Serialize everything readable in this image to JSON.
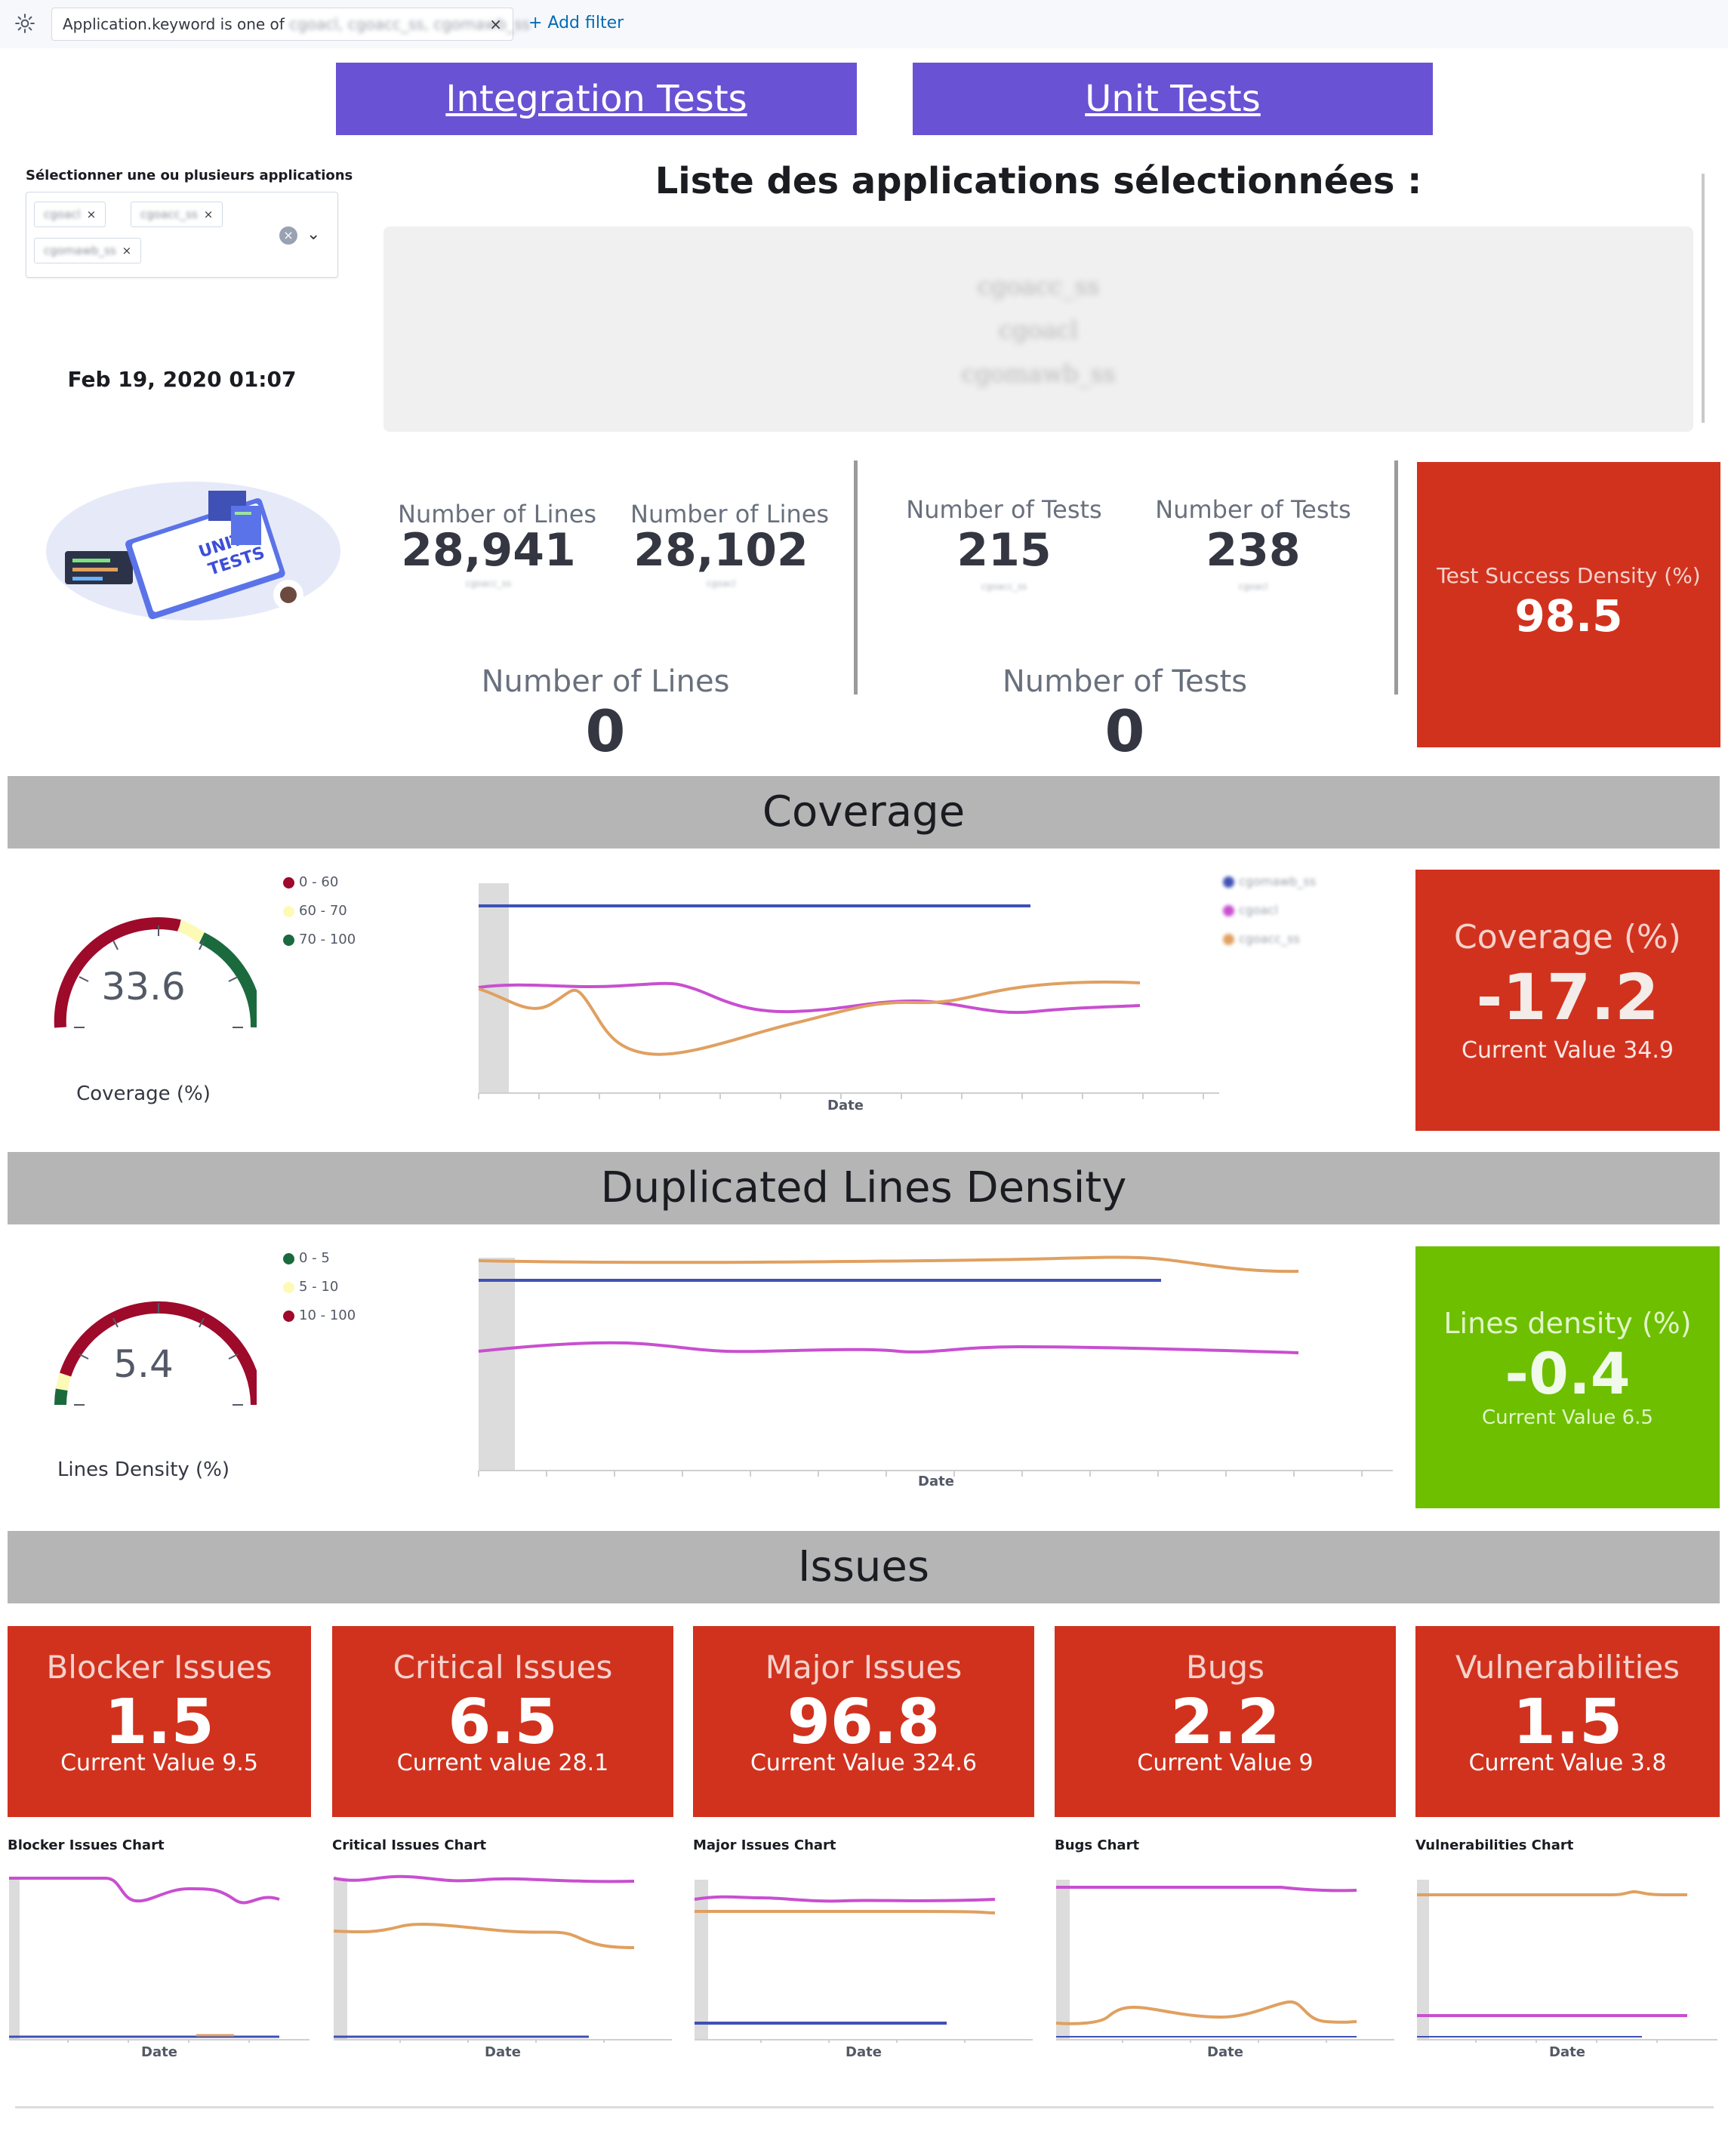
{
  "filter_bar": {
    "filter_prefix": "Application.keyword is one of",
    "filter_values": "cgoacl, cgoacc_ss, cgomawb_ss",
    "filter_close": "×",
    "add_filter": "+ Add filter"
  },
  "nav_buttons": {
    "integration": "Integration Tests",
    "unit": "Unit Tests"
  },
  "selector": {
    "label": "Sélectionner une ou plusieurs applications",
    "chips": [
      "cgoacl",
      "cgoacc_ss",
      "cgomawb_ss"
    ],
    "chip_close": "×",
    "clear": "×",
    "chevron": "⌄"
  },
  "date": "Feb 19, 2020 01:07",
  "applications": {
    "title": "Liste des applications sélectionnées :",
    "items": [
      "cgoacc_ss",
      "cgoacl",
      "cgomawb_ss"
    ]
  },
  "illustration": {
    "line1": "UNIT",
    "line2": "TESTS"
  },
  "metrics": {
    "lines": [
      {
        "label": "Number of Lines",
        "value": "28,941",
        "sub": "cgoacc_ss"
      },
      {
        "label": "Number of Lines",
        "value": "28,102",
        "sub": "cgoacl"
      }
    ],
    "tests": [
      {
        "label": "Number of Tests",
        "value": "215",
        "sub": "cgoacc_ss"
      },
      {
        "label": "Number of Tests",
        "value": "238",
        "sub": "cgoacl"
      }
    ],
    "lines_total": {
      "label": "Number of Lines",
      "value": "0"
    },
    "tests_total": {
      "label": "Number of Tests",
      "value": "0"
    }
  },
  "test_success": {
    "label": "Test Success Density (%)",
    "value": "98.5",
    "color": "#d1321e"
  },
  "sections": {
    "coverage": "Coverage",
    "duplicated": "Duplicated Lines Density",
    "issues": "Issues"
  },
  "coverage": {
    "gauge": {
      "value": 33.6,
      "display": "33.6",
      "label": "Coverage (%)",
      "min": 0,
      "max": 100
    },
    "gauge_legend": [
      {
        "label": "0 - 60",
        "color": "#9e0a2a"
      },
      {
        "label": "60 - 70",
        "color": "#fdfab8"
      },
      {
        "label": "70 - 100",
        "color": "#1b6a3d"
      }
    ],
    "series_legend": [
      {
        "label": "cgomawb_ss",
        "color": "#3f51b5"
      },
      {
        "label": "cgoacl",
        "color": "#c84fd0"
      },
      {
        "label": "cgoacc_ss",
        "color": "#e0a060"
      }
    ],
    "xlabel": "Date",
    "tile": {
      "label": "Coverage (%)",
      "value": "-17.2",
      "current": "Current Value 34.9",
      "color": "#d1321e"
    }
  },
  "duplicated": {
    "gauge": {
      "value": 5.4,
      "display": "5.4",
      "label": "Lines Density (%)",
      "min": 0,
      "max": 100
    },
    "gauge_legend": [
      {
        "label": "0 - 5",
        "color": "#1b6a3d"
      },
      {
        "label": "5 - 10",
        "color": "#fdfab8"
      },
      {
        "label": "10 - 100",
        "color": "#9e0a2a"
      }
    ],
    "xlabel": "Date",
    "tile": {
      "label": "Lines density (%)",
      "value": "-0.4",
      "current": "Current Value 6.5",
      "color": "#6dbf00"
    }
  },
  "issues": [
    {
      "label": "Blocker Issues",
      "value": "1.5",
      "current": "Current Value 9.5",
      "chart_title": "Blocker Issues Chart",
      "xlabel": "Date"
    },
    {
      "label": "Critical Issues",
      "value": "6.5",
      "current": "Current value 28.1",
      "chart_title": "Critical Issues Chart",
      "xlabel": "Date"
    },
    {
      "label": "Major Issues",
      "value": "96.8",
      "current": "Current Value 324.6",
      "chart_title": "Major Issues Chart",
      "xlabel": "Date"
    },
    {
      "label": "Bugs",
      "value": "2.2",
      "current": "Current Value 9",
      "chart_title": "Bugs Chart",
      "xlabel": "Date"
    },
    {
      "label": "Vulnerabilities",
      "value": "1.5",
      "current": "Current Value 3.8",
      "chart_title": "Vulnerabilities Chart",
      "xlabel": "Date"
    }
  ],
  "colors": {
    "accent_purple": "#6a52d4",
    "alert_red": "#d1321e",
    "ok_green": "#6dbf00",
    "section_gray": "#b5b5b5"
  },
  "icons": {
    "settings": "gear-icon",
    "clear": "clear-icon",
    "chevron": "chevron-down-icon"
  }
}
